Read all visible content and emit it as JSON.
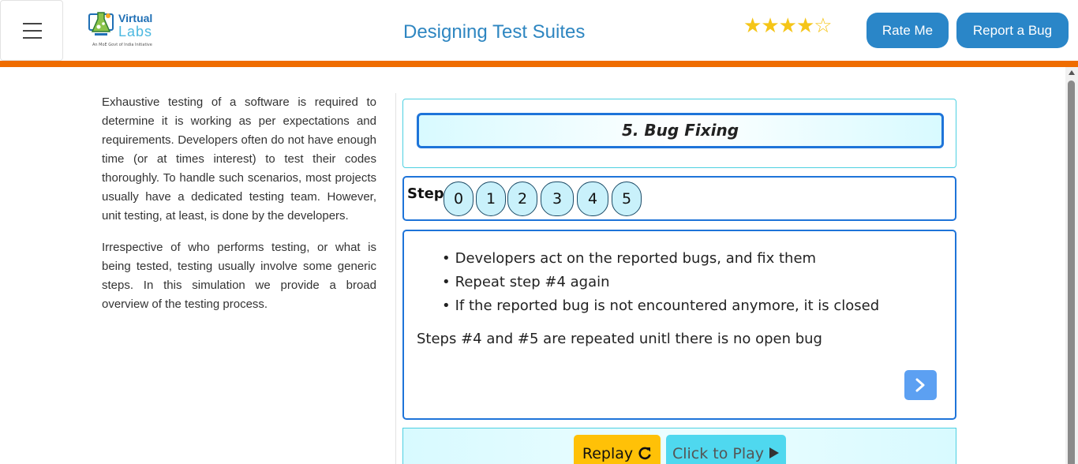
{
  "header": {
    "logo": {
      "line1": "Virtual",
      "line2": "Labs",
      "tagline": "An MoE Govt of India Initiative"
    },
    "title": "Designing Test Suites",
    "rating": {
      "filled": 4,
      "total": 5
    },
    "rate_label": "Rate Me",
    "bug_label": "Report a Bug"
  },
  "sidebar": {
    "paragraphs": [
      "Exhaustive testing of a software is required to determine it is working as per expectations and requirements. Developers often do not have enough time (or at times interest) to test their codes thoroughly. To handle such scenarios, most projects usually have a dedicated testing team. However, unit testing, at least, is done by the developers.",
      "Irrespective of who performs testing, or what is being tested, testing usually involve some generic steps. In this simulation we provide a broad overview of the testing process."
    ]
  },
  "simulation": {
    "section_title": "5. Bug Fixing",
    "step_label": "Step",
    "steps": [
      "0",
      "1",
      "2",
      "3",
      "4",
      "5"
    ],
    "bullets": [
      "Developers act on the reported bugs, and fix them",
      "Repeat step #4 again",
      "If the reported bug is not encountered anymore, it is closed"
    ],
    "note": "Steps #4 and #5 are repeated unitl there is no open bug",
    "replay_label": "Replay",
    "play_label": "Click to Play"
  },
  "colors": {
    "accent_orange": "#ef6c00",
    "primary_blue": "#2a86c8",
    "panel_border": "#1e74d9",
    "replay_yellow": "#ffc107",
    "play_cyan": "#4fd8ef"
  },
  "icons": [
    "hamburger-icon",
    "star-icon",
    "chevron-right-icon",
    "replay-icon",
    "play-icon"
  ]
}
